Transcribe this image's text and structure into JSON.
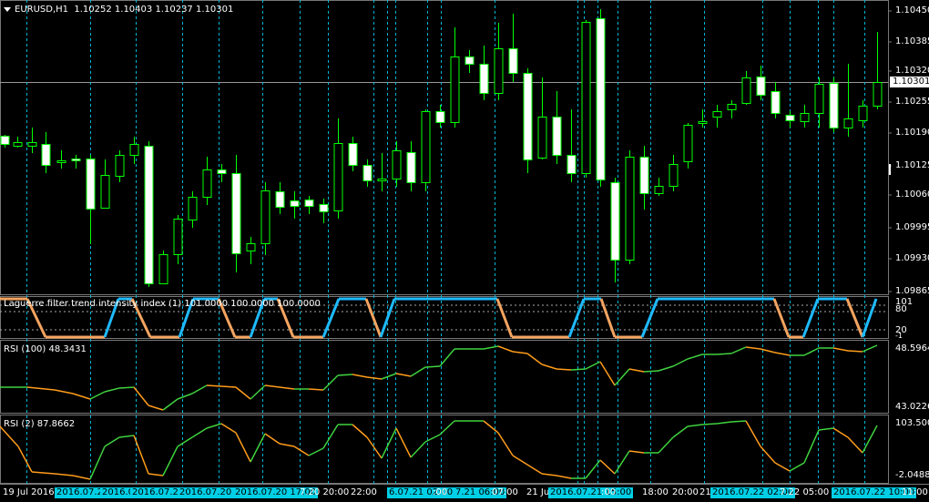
{
  "main_chart": {
    "symbol_tf": "EURUSD,H1",
    "ohlc": "1.10252 1.10403 1.10237 1.10301",
    "price_axis": [
      "1.10450",
      "1.10385",
      "1.10320",
      "1.10255",
      "1.10190",
      "1.10125",
      "1.10060",
      "1.09995",
      "1.09930",
      "1.09865"
    ],
    "current_price": "1.10301"
  },
  "laguerre": {
    "title": "Laguerre filter trend intensity index (1) 101.0000 100.0000 100.0000",
    "levels": [
      "101",
      "80",
      "20",
      "-1"
    ]
  },
  "rsi100": {
    "title": "RSI (100) 48.3431",
    "max": "48.5964",
    "min": "43.0226"
  },
  "rsi2": {
    "title": "RSI (2) 87.8662",
    "max": "103.5008",
    "min": "-2.0488"
  },
  "time_axis": {
    "first": "19 Jul 2016",
    "labels": [
      {
        "text": "2016.07.20",
        "hl": true
      },
      {
        "text": "2016.0",
        "hl": true
      },
      {
        "text": "2016.07.20",
        "hl": true
      },
      {
        "text": "2016.07.20",
        "hl": true
      },
      {
        "text": "2016.07.20 17:00",
        "hl": true
      },
      {
        "text": "7.20 20:00",
        "hl": false
      },
      {
        "text": "22:00",
        "hl": false
      },
      {
        "text": "6.07.21 02:00",
        "hl": true
      },
      {
        "text": ":00",
        "hl": false
      },
      {
        "text": "7.21 06:00",
        "hl": true
      },
      {
        "text": "07:00",
        "hl": false
      },
      {
        "text": "21 Jul",
        "hl": false
      },
      {
        "text": "2016.07.21 15:00",
        "hl": true
      },
      {
        "text": ":00",
        "hl": false
      },
      {
        "text": "18:00",
        "hl": false
      },
      {
        "text": "20:00",
        "hl": false
      },
      {
        "text": "21",
        "hl": false
      },
      {
        "text": "2016.07.22 02:00",
        "hl": true
      },
      {
        "text": "7.22 05:00",
        "hl": false
      },
      {
        "text": "2016.07.22 10:00",
        "hl": true
      },
      {
        "text": "11:00",
        "hl": false
      }
    ]
  },
  "colors": {
    "bull": "#00ff00",
    "bear_body": "#ffffff",
    "wick": "#00ff00",
    "laguerre_up": "#1ebaff",
    "laguerre_down": "#f4a460",
    "rsi_up": "#3fd23f",
    "rsi_down": "#ff9c1a",
    "vline": "#00b7d7"
  }
}
